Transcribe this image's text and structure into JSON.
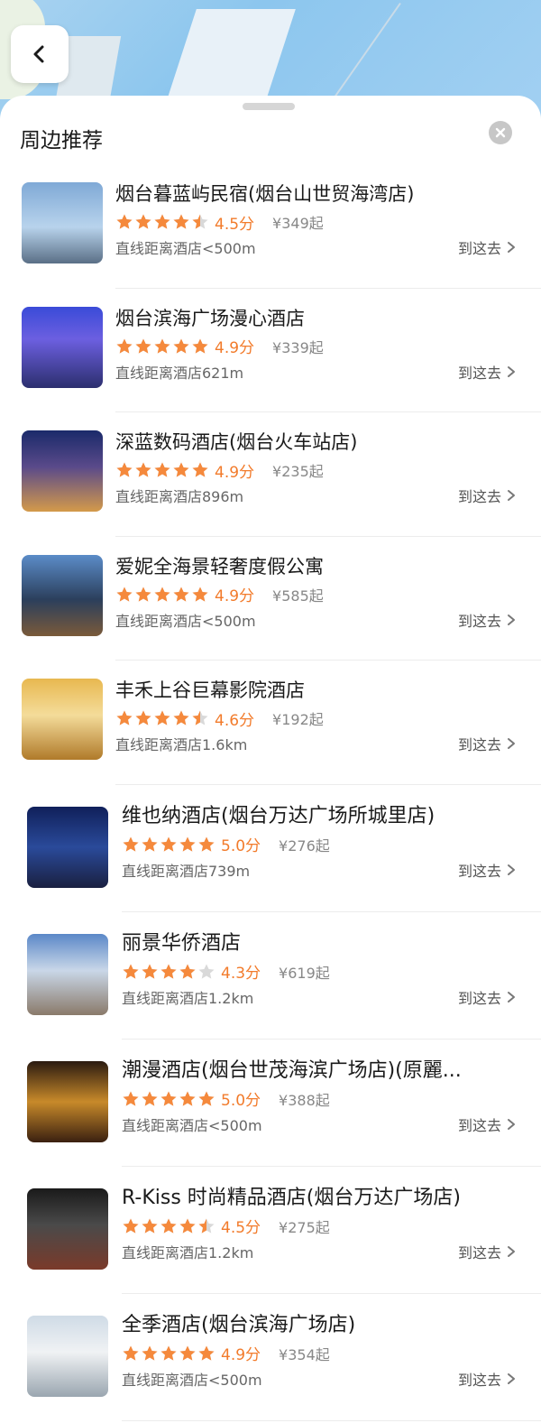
{
  "header": {
    "back_icon": "chevron-left-icon"
  },
  "sheet": {
    "title": "周边推荐",
    "close_icon": "close-icon"
  },
  "colors": {
    "star": "#f5893c",
    "star_empty": "#d9d9d9",
    "score": "#f27b2b"
  },
  "hotels": [
    {
      "name": "烟台暮蓝屿民宿(烟台山世贸海湾店)",
      "rating": 4.5,
      "score": "4.5分",
      "price": "¥349起",
      "distance": "直线距离酒店<500m",
      "go": "到这去"
    },
    {
      "name": "烟台滨海广场漫心酒店",
      "rating": 4.9,
      "score": "4.9分",
      "price": "¥339起",
      "distance": "直线距离酒店621m",
      "go": "到这去"
    },
    {
      "name": "深蓝数码酒店(烟台火车站店)",
      "rating": 4.9,
      "score": "4.9分",
      "price": "¥235起",
      "distance": "直线距离酒店896m",
      "go": "到这去"
    },
    {
      "name": "爱妮全海景轻奢度假公寓",
      "rating": 4.9,
      "score": "4.9分",
      "price": "¥585起",
      "distance": "直线距离酒店<500m",
      "go": "到这去"
    },
    {
      "name": "丰禾上谷巨幕影院酒店",
      "rating": 4.6,
      "score": "4.6分",
      "price": "¥192起",
      "distance": "直线距离酒店1.6km",
      "go": "到这去"
    },
    {
      "name": "维也纳酒店(烟台万达广场所城里店)",
      "rating": 5.0,
      "score": "5.0分",
      "price": "¥276起",
      "distance": "直线距离酒店739m",
      "go": "到这去"
    },
    {
      "name": "丽景华侨酒店",
      "rating": 4.3,
      "score": "4.3分",
      "price": "¥619起",
      "distance": "直线距离酒店1.2km",
      "go": "到这去"
    },
    {
      "name": "潮漫酒店(烟台世茂海滨广场店)(原麗...",
      "rating": 5.0,
      "score": "5.0分",
      "price": "¥388起",
      "distance": "直线距离酒店<500m",
      "go": "到这去"
    },
    {
      "name": "R-Kiss 时尚精品酒店(烟台万达广场店)",
      "rating": 4.5,
      "score": "4.5分",
      "price": "¥275起",
      "distance": "直线距离酒店1.2km",
      "go": "到这去"
    },
    {
      "name": "全季酒店(烟台滨海广场店)",
      "rating": 4.9,
      "score": "4.9分",
      "price": "¥354起",
      "distance": "直线距离酒店<500m",
      "go": "到这去"
    }
  ]
}
